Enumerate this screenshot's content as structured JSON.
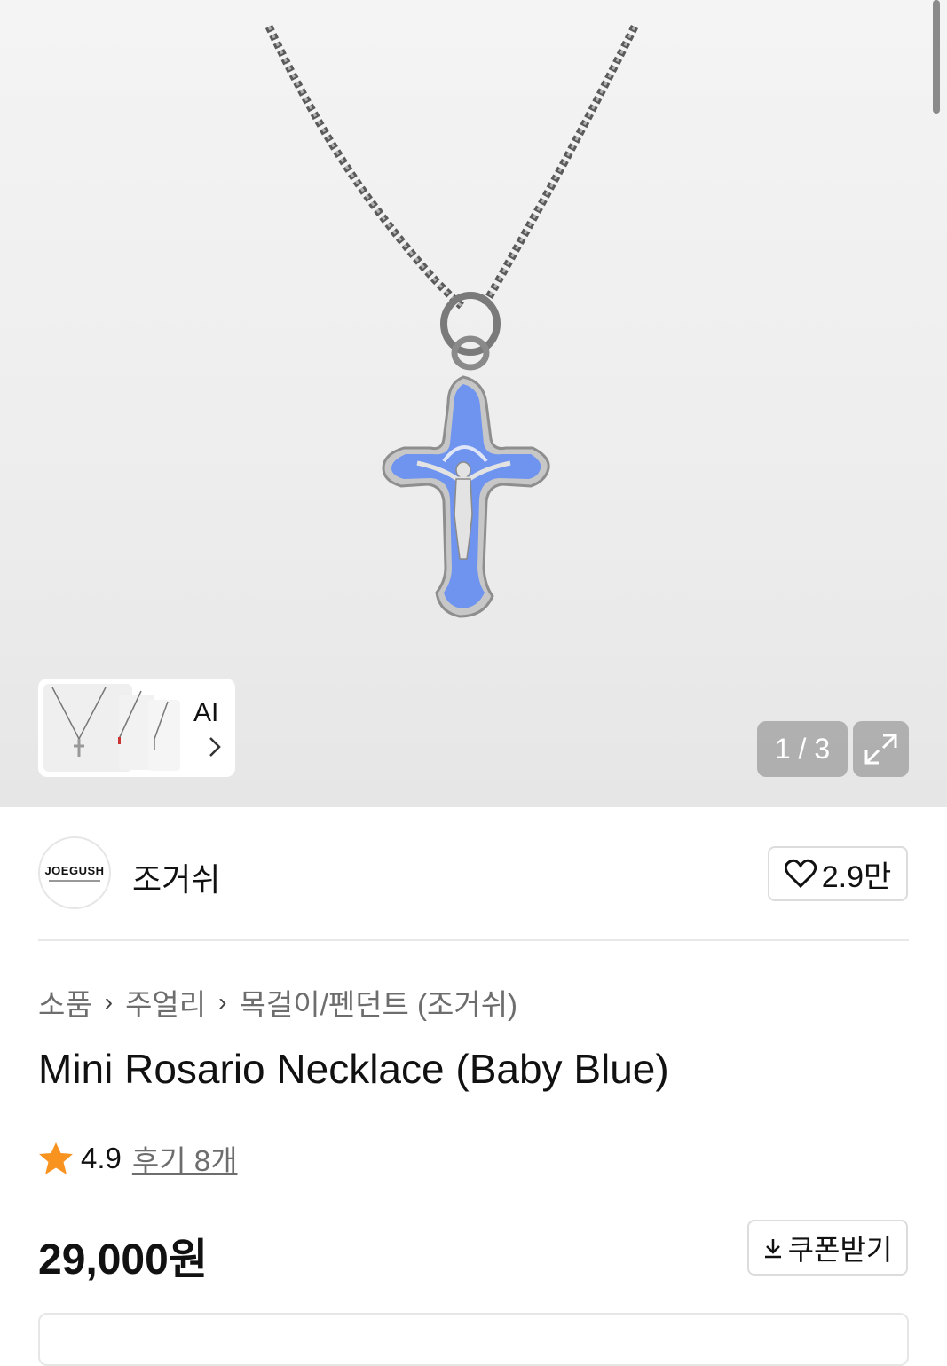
{
  "gallery": {
    "ai_label": "AI",
    "image_index": "1 / 3"
  },
  "brand": {
    "logo_text": "JOEGUSH",
    "name": "조거쉬",
    "likes": "2.9만"
  },
  "breadcrumb": [
    "소품",
    "주얼리",
    "목걸이/펜던트 (조거쉬)"
  ],
  "product": {
    "title": "Mini Rosario Necklace (Baby Blue)",
    "rating": "4.9",
    "reviews_label": "후기 8개",
    "price": "29,000원",
    "coupon_label": "쿠폰받기"
  },
  "colors": {
    "cross_enamel": "#6f94ef",
    "star": "#f7931e"
  }
}
